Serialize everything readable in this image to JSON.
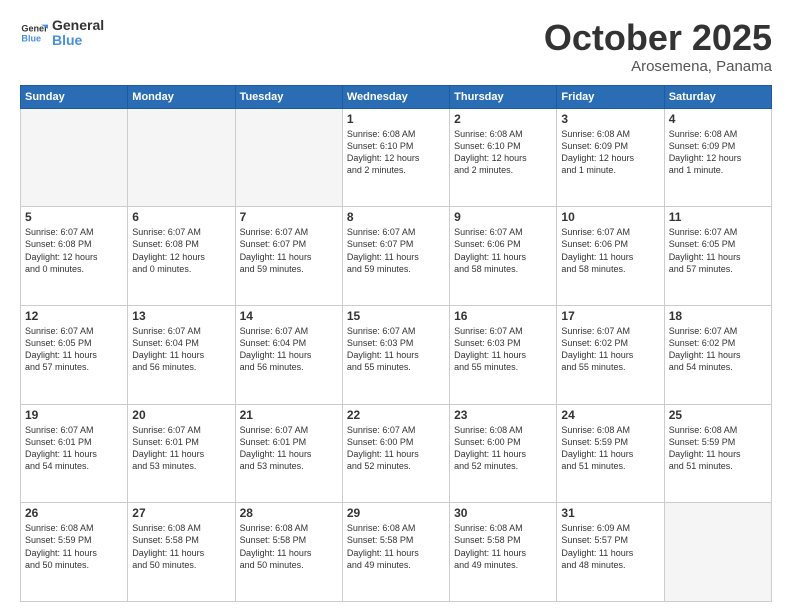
{
  "logo": {
    "line1": "General",
    "line2": "Blue"
  },
  "title": "October 2025",
  "location": "Arosemena, Panama",
  "days_header": [
    "Sunday",
    "Monday",
    "Tuesday",
    "Wednesday",
    "Thursday",
    "Friday",
    "Saturday"
  ],
  "weeks": [
    [
      {
        "num": "",
        "info": ""
      },
      {
        "num": "",
        "info": ""
      },
      {
        "num": "",
        "info": ""
      },
      {
        "num": "1",
        "info": "Sunrise: 6:08 AM\nSunset: 6:10 PM\nDaylight: 12 hours\nand 2 minutes."
      },
      {
        "num": "2",
        "info": "Sunrise: 6:08 AM\nSunset: 6:10 PM\nDaylight: 12 hours\nand 2 minutes."
      },
      {
        "num": "3",
        "info": "Sunrise: 6:08 AM\nSunset: 6:09 PM\nDaylight: 12 hours\nand 1 minute."
      },
      {
        "num": "4",
        "info": "Sunrise: 6:08 AM\nSunset: 6:09 PM\nDaylight: 12 hours\nand 1 minute."
      }
    ],
    [
      {
        "num": "5",
        "info": "Sunrise: 6:07 AM\nSunset: 6:08 PM\nDaylight: 12 hours\nand 0 minutes."
      },
      {
        "num": "6",
        "info": "Sunrise: 6:07 AM\nSunset: 6:08 PM\nDaylight: 12 hours\nand 0 minutes."
      },
      {
        "num": "7",
        "info": "Sunrise: 6:07 AM\nSunset: 6:07 PM\nDaylight: 11 hours\nand 59 minutes."
      },
      {
        "num": "8",
        "info": "Sunrise: 6:07 AM\nSunset: 6:07 PM\nDaylight: 11 hours\nand 59 minutes."
      },
      {
        "num": "9",
        "info": "Sunrise: 6:07 AM\nSunset: 6:06 PM\nDaylight: 11 hours\nand 58 minutes."
      },
      {
        "num": "10",
        "info": "Sunrise: 6:07 AM\nSunset: 6:06 PM\nDaylight: 11 hours\nand 58 minutes."
      },
      {
        "num": "11",
        "info": "Sunrise: 6:07 AM\nSunset: 6:05 PM\nDaylight: 11 hours\nand 57 minutes."
      }
    ],
    [
      {
        "num": "12",
        "info": "Sunrise: 6:07 AM\nSunset: 6:05 PM\nDaylight: 11 hours\nand 57 minutes."
      },
      {
        "num": "13",
        "info": "Sunrise: 6:07 AM\nSunset: 6:04 PM\nDaylight: 11 hours\nand 56 minutes."
      },
      {
        "num": "14",
        "info": "Sunrise: 6:07 AM\nSunset: 6:04 PM\nDaylight: 11 hours\nand 56 minutes."
      },
      {
        "num": "15",
        "info": "Sunrise: 6:07 AM\nSunset: 6:03 PM\nDaylight: 11 hours\nand 55 minutes."
      },
      {
        "num": "16",
        "info": "Sunrise: 6:07 AM\nSunset: 6:03 PM\nDaylight: 11 hours\nand 55 minutes."
      },
      {
        "num": "17",
        "info": "Sunrise: 6:07 AM\nSunset: 6:02 PM\nDaylight: 11 hours\nand 55 minutes."
      },
      {
        "num": "18",
        "info": "Sunrise: 6:07 AM\nSunset: 6:02 PM\nDaylight: 11 hours\nand 54 minutes."
      }
    ],
    [
      {
        "num": "19",
        "info": "Sunrise: 6:07 AM\nSunset: 6:01 PM\nDaylight: 11 hours\nand 54 minutes."
      },
      {
        "num": "20",
        "info": "Sunrise: 6:07 AM\nSunset: 6:01 PM\nDaylight: 11 hours\nand 53 minutes."
      },
      {
        "num": "21",
        "info": "Sunrise: 6:07 AM\nSunset: 6:01 PM\nDaylight: 11 hours\nand 53 minutes."
      },
      {
        "num": "22",
        "info": "Sunrise: 6:07 AM\nSunset: 6:00 PM\nDaylight: 11 hours\nand 52 minutes."
      },
      {
        "num": "23",
        "info": "Sunrise: 6:08 AM\nSunset: 6:00 PM\nDaylight: 11 hours\nand 52 minutes."
      },
      {
        "num": "24",
        "info": "Sunrise: 6:08 AM\nSunset: 5:59 PM\nDaylight: 11 hours\nand 51 minutes."
      },
      {
        "num": "25",
        "info": "Sunrise: 6:08 AM\nSunset: 5:59 PM\nDaylight: 11 hours\nand 51 minutes."
      }
    ],
    [
      {
        "num": "26",
        "info": "Sunrise: 6:08 AM\nSunset: 5:59 PM\nDaylight: 11 hours\nand 50 minutes."
      },
      {
        "num": "27",
        "info": "Sunrise: 6:08 AM\nSunset: 5:58 PM\nDaylight: 11 hours\nand 50 minutes."
      },
      {
        "num": "28",
        "info": "Sunrise: 6:08 AM\nSunset: 5:58 PM\nDaylight: 11 hours\nand 50 minutes."
      },
      {
        "num": "29",
        "info": "Sunrise: 6:08 AM\nSunset: 5:58 PM\nDaylight: 11 hours\nand 49 minutes."
      },
      {
        "num": "30",
        "info": "Sunrise: 6:08 AM\nSunset: 5:58 PM\nDaylight: 11 hours\nand 49 minutes."
      },
      {
        "num": "31",
        "info": "Sunrise: 6:09 AM\nSunset: 5:57 PM\nDaylight: 11 hours\nand 48 minutes."
      },
      {
        "num": "",
        "info": ""
      }
    ]
  ]
}
